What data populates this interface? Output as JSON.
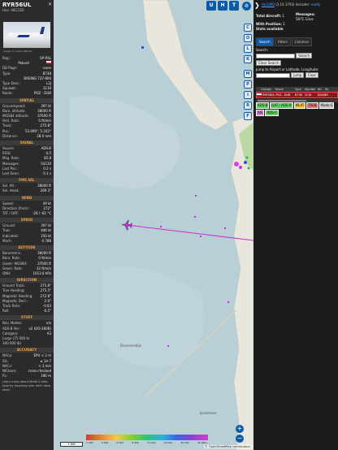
{
  "aircraft": {
    "callsign": "RYR56UL",
    "hex_label": "Hex: 48C22B",
    "photo_credit": "Image © Laszlo Rabota",
    "details": [
      {
        "k": "Reg.:",
        "v": "SP-RSL"
      },
      {
        "k": "",
        "v": "Poland"
      },
      {
        "k": "DB flags:",
        "v": "none"
      },
      {
        "k": "Type:",
        "v": "B738"
      },
      {
        "k": "",
        "v": "BOEING 737-800"
      },
      {
        "k": "Type Desc.:",
        "v": "L2J"
      },
      {
        "k": "Squawk:",
        "v": "3116"
      },
      {
        "k": "Route:",
        "v": "POZ - DUB"
      }
    ],
    "sections": [
      {
        "title": "SPATIAL",
        "rows": [
          {
            "k": "Groundspeed:",
            "v": "397 kt"
          },
          {
            "k": "Baro. altitude:",
            "v": "38000 ft"
          },
          {
            "k": "WGS84 altitude:",
            "v": "37600 ft"
          },
          {
            "k": "Vert. Rate:",
            "v": "0 ft/min"
          },
          {
            "k": "Track:",
            "v": "275.8°"
          },
          {
            "k": "Pos.:",
            "v": "53.090°, 5.162°"
          },
          {
            "k": "Distance:",
            "v": "28.0 nmi"
          }
        ]
      },
      {
        "title": "SIGNAL",
        "rows": [
          {
            "k": "Source:",
            "v": "ADS-B"
          },
          {
            "k": "RSSI:",
            "v": "-4.5"
          },
          {
            "k": "Msg. Rate:",
            "v": "85.8"
          },
          {
            "k": "Messages:",
            "v": "54130"
          },
          {
            "k": "Last Pos.:",
            "v": "0.2 s"
          },
          {
            "k": "Last Seen:",
            "v": "0.1 s"
          }
        ]
      },
      {
        "title": "FMS SEL",
        "rows": [
          {
            "k": "Sel. Alt.:",
            "v": "38000 ft"
          },
          {
            "k": "Sel. Head.:",
            "v": "269.3°"
          }
        ]
      },
      {
        "title": "WIND",
        "rows": [
          {
            "k": "Speed:",
            "v": "49 kt"
          },
          {
            "k": "Direction (from):",
            "v": "272°"
          },
          {
            "k": "TAT / OAT:",
            "v": "-26 / -62 °C"
          }
        ]
      },
      {
        "title": "SPEED",
        "rows": [
          {
            "k": "Ground:",
            "v": "397 kt"
          },
          {
            "k": "True:",
            "v": "446 kt"
          },
          {
            "k": "Indicated:",
            "v": "250 kt"
          },
          {
            "k": "Mach:",
            "v": "0.788"
          }
        ]
      },
      {
        "title": "ALTITUDE",
        "rows": [
          {
            "k": "Barometric:",
            "v": "38000 ft"
          },
          {
            "k": "Baro. Rate:",
            "v": "0 ft/min"
          },
          {
            "k": "Geom. WGS84:",
            "v": "37600 ft"
          },
          {
            "k": "Geom. Rate:",
            "v": "32 ft/min"
          },
          {
            "k": "QNH:",
            "v": "1013.6 hPa"
          }
        ]
      },
      {
        "title": "DIRECTION",
        "rows": [
          {
            "k": "Ground Track:",
            "v": "275.8°"
          },
          {
            "k": "True Heading:",
            "v": "275.5°"
          },
          {
            "k": "Magnetic Heading:",
            "v": "272.8°"
          },
          {
            "k": "Magnetic Decl.:",
            "v": "2.6°"
          },
          {
            "k": "Track Rate:",
            "v": "-0.03"
          },
          {
            "k": "Roll:",
            "v": "-0.5°"
          }
        ]
      },
      {
        "title": "STUFF",
        "rows": [
          {
            "k": "Nav. Modes:",
            "v": "n/a"
          },
          {
            "k": "ADS-B Ver.:",
            "v": "v2 (DO-260B)"
          },
          {
            "k": "Category:",
            "v": "A3"
          },
          {
            "k": "Large (75 000 to",
            "v": ""
          },
          {
            "k": "300 000 lb)",
            "v": ""
          }
        ]
      },
      {
        "title": "ACCURACY",
        "rows": [
          {
            "k": "NACp:",
            "v": "EPU < 3 m"
          },
          {
            "k": "SIL:",
            "v": "≤ 1e-7"
          },
          {
            "k": "NACv:",
            "v": "< 3 m/s"
          },
          {
            "k": "NICbaro:",
            "v": "cross-checked"
          },
          {
            "k": "Rc:",
            "v": "186 m"
          }
        ]
      }
    ],
    "learn_more": "Learn more about Mode S data type by hovering over each data label."
  },
  "map": {
    "buttons": [
      "U",
      "H",
      "T"
    ],
    "side_buttons": [
      "C",
      "O",
      "L",
      "K",
      "M",
      "P",
      "I",
      "R",
      "F"
    ],
    "zoom_in": "+",
    "zoom_out": "−",
    "scale_label": "1 NM",
    "altitude_labels": [
      "2 000",
      "4 000",
      "6 000",
      "8 000",
      "10 000",
      "20 000",
      "30 000",
      "40 000+"
    ],
    "place_label": "Breezanddijk",
    "place_label_2": "IJsselmeer",
    "credit": "© OpenStreetMap contributors."
  },
  "panel": {
    "arrow": "❯",
    "version_link": "tar1090",
    "version_text": " (3.14.1793) decoder: ",
    "ready": "ready",
    "total_label": "Total Aircraft:",
    "total_value": "1",
    "messages_label": "Messages:",
    "messages_value": "5871.1/sec",
    "with_pos_label": "With Position:",
    "with_pos_value": "1",
    "stats_text": "Stats available",
    "tabs": [
      "Search",
      "Filters",
      "Columns"
    ],
    "search_label": "Search:",
    "search_button": "Search",
    "clear_search": "Clear Search",
    "jump_label": "Jump to Airport or Latitude, Longitude:",
    "jump_button": "Jump",
    "clear_button": "Clear",
    "columns": [
      "Callsign",
      "Route",
      "Type",
      "Squawk",
      "Alt.",
      "Sp"
    ],
    "row": [
      "RYR56UL",
      "POZ - DUB",
      "B738",
      "3116",
      "38000",
      "39"
    ],
    "filter_chips": [
      {
        "label": "ADS-B",
        "color": "#5fd05f"
      },
      {
        "label": "UAT / ADS-R",
        "color": "#5fd05f"
      },
      {
        "label": "MLAT",
        "color": "#f0c040"
      },
      {
        "label": "TIS-B",
        "color": "#e07070"
      },
      {
        "label": "Mode-S",
        "color": "#c8c8c8"
      },
      {
        "label": "AIS",
        "color": "#d080d0"
      },
      {
        "label": "ADS-C",
        "color": "#5fd05f"
      }
    ]
  },
  "colors": {
    "accent": "#0b5aa8",
    "track": "#c830d0",
    "water": "#b8cfd6",
    "land": "#e9e7dd"
  }
}
